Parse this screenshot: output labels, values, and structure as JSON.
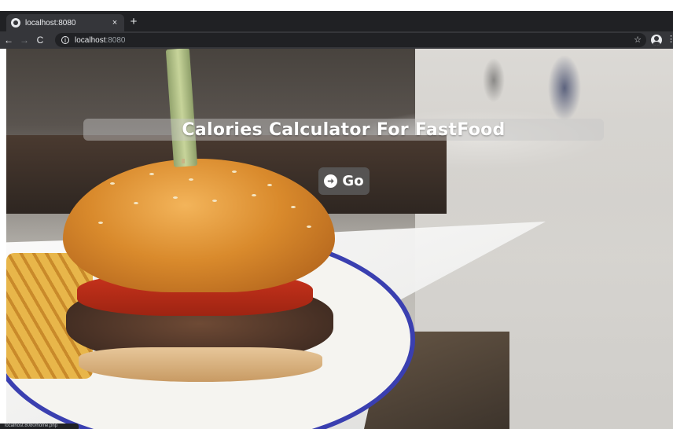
{
  "browser": {
    "tab_title": "localhost:8080",
    "tab_close": "×",
    "new_tab": "+",
    "back": "←",
    "forward": "→",
    "reload": "C",
    "info": "i",
    "url_host": "localhost",
    "url_port": ":8080",
    "star": "☆",
    "menu": "⋮",
    "status_text": "localhost:8080/home.php"
  },
  "page": {
    "title": "Calories Calculator For FastFood",
    "go_label": "Go"
  }
}
